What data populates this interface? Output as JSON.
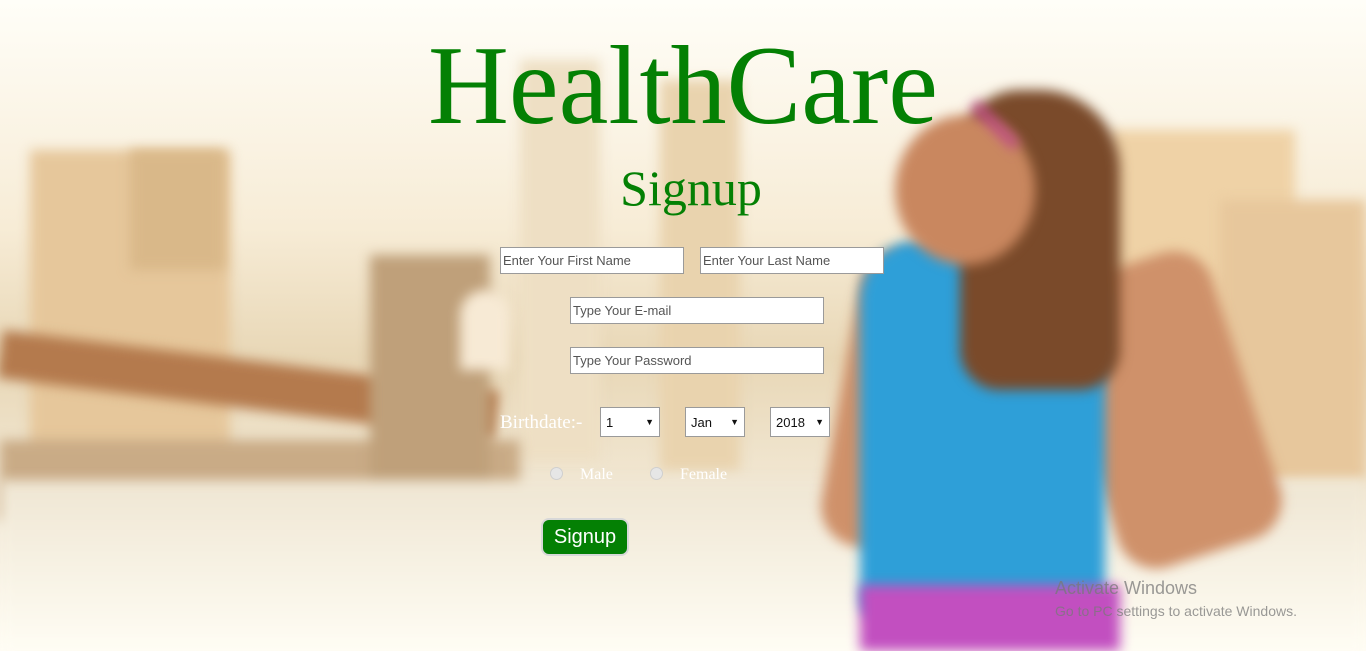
{
  "brand": {
    "title": "HealthCare",
    "color": "#048004"
  },
  "form": {
    "heading": "Signup",
    "first_name_placeholder": "Enter Your First Name",
    "last_name_placeholder": "Enter Your Last Name",
    "email_placeholder": "Type Your E-mail",
    "password_placeholder": "Type Your Password",
    "birthdate": {
      "label": "Birthdate:-",
      "day": "1",
      "month": "Jan",
      "year": "2018"
    },
    "gender": {
      "male_label": "Male",
      "female_label": "Female"
    },
    "submit_label": "Signup"
  },
  "watermark": {
    "line1": "Activate Windows",
    "line2": "Go to PC settings to activate Windows."
  }
}
